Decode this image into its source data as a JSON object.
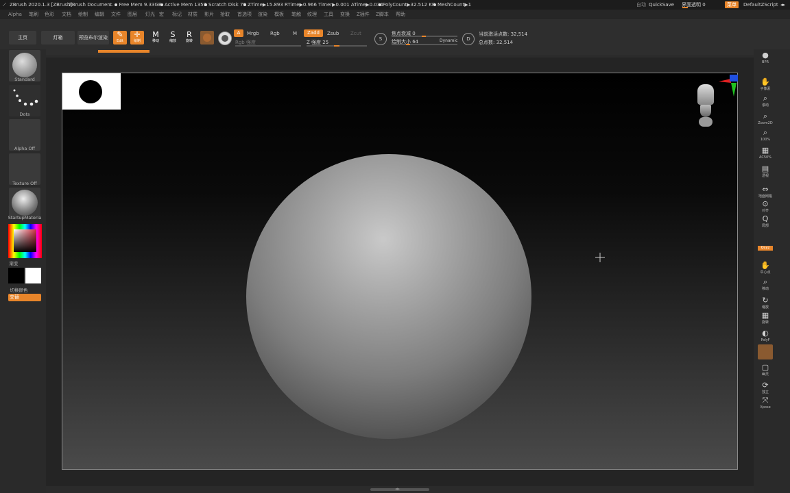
{
  "title_bar": {
    "app": "ZBrush 2020.1.3 [ZBrush]",
    "document": "ZBrush Document",
    "free_mem": "Free Mem 9.33GB",
    "active_mem": "Active Mem 1359",
    "scratch_disk": "Scratch Disk 70",
    "timing": "ZTime▶15.893 RTime▶0.966 Timer▶0.001 ATime▶0.034",
    "poly_count": "PolyCount▶32.512 KP",
    "mesh_count": "MeshCount▶1",
    "menus_label": "菜单",
    "quicksave": "QuickSave",
    "interface_transparency": "界面透明 0",
    "default_zscript": "DefaultZScript",
    "auto_label": "自动"
  },
  "menu_bar": [
    "Alpha",
    "笔刷",
    "色彩",
    "文档",
    "绘制",
    "编辑",
    "文件",
    "图层",
    "灯光",
    "宏",
    "标记",
    "材质",
    "影片",
    "拾取",
    "首选项",
    "渲染",
    "模板",
    "笔触",
    "纹理",
    "工具",
    "变换",
    "Z插件",
    "Z脚本",
    "帮助"
  ],
  "shelf": {
    "tabs": [
      "主页",
      "灯箱",
      "预览布尔渲染"
    ],
    "edit": "Edit",
    "draw": "绘制",
    "move": "移动",
    "scale": "缩放",
    "rotate": "旋转",
    "mrgb": "Mrgb",
    "rgb": "Rgb",
    "m": "M",
    "a": "A",
    "zadd": "Zadd",
    "zsub": "Zsub",
    "zcut": "Zcut",
    "rgb_intensity": "Rgb 强度",
    "z_intensity": "Z 强度 25",
    "z_intensity_value": 25,
    "focal_shift": "焦点衰减 0",
    "focal_shift_value": 0,
    "draw_size": "绘制大小 64",
    "draw_size_value": 64,
    "dynamic": "Dynamic",
    "active_points": "当前激活点数: 32,514",
    "total_points": "总点数: 32,514"
  },
  "left_panel": {
    "brush": "Standard",
    "stroke": "Dots",
    "alpha": "Alpha Off",
    "texture": "Texture Off",
    "material": "StartupMateria",
    "gradient": "渐变",
    "switch_color": "切换颜色",
    "alternate": "交替"
  },
  "right_panel": [
    "BPR",
    "子像素",
    "滚动",
    "Zoom2D",
    "100%",
    "AC50%",
    "透视",
    "地面网格",
    "对齐",
    "局部",
    "Qxyz",
    "中心点",
    "移动",
    "缩放",
    "旋转",
    "PolyF",
    "透明",
    "幽灵",
    "独立",
    "Xpose"
  ],
  "colors": {
    "accent": "#e8852a",
    "title_bg": "#1c1c1c",
    "panel_bg": "#2a2a2a",
    "canvas_top": "#000000",
    "canvas_bottom": "#4a4a4a"
  }
}
